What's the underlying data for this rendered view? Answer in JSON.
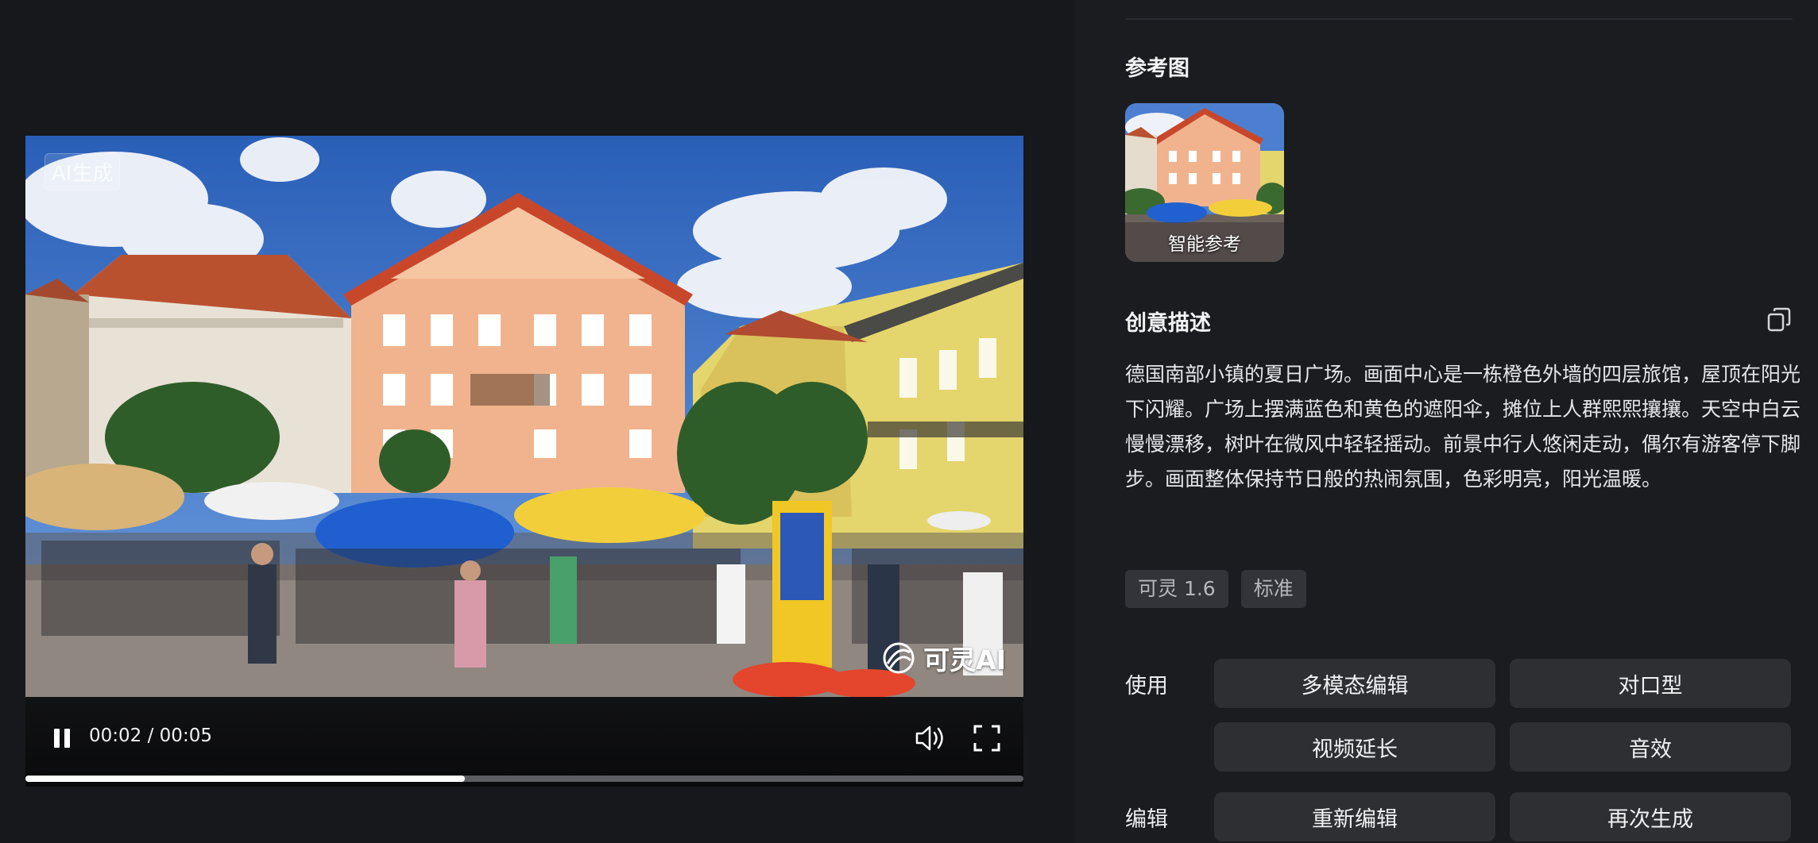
{
  "player": {
    "ai_tag": "AI生成",
    "watermark": "可灵AI",
    "time_current": "00:02",
    "time_separator": " / ",
    "time_total": "00:05",
    "progress_fraction": 0.44,
    "icons": {
      "pause": "pause-icon",
      "volume": "volume-icon",
      "fullscreen": "fullscreen-icon",
      "logo": "kling-logo-icon"
    }
  },
  "panel": {
    "reference": {
      "title": "参考图",
      "thumb_label": "智能参考"
    },
    "description": {
      "title": "创意描述",
      "copy_icon": "copy-icon",
      "text": "德国南部小镇的夏日广场。画面中心是一栋橙色外墙的四层旅馆，屋顶在阳光下闪耀。广场上摆满蓝色和黄色的遮阳伞，摊位上人群熙熙攘攘。天空中白云慢慢漂移，树叶在微风中轻轻摇动。前景中行人悠闲走动，偶尔有游客停下脚步。画面整体保持节日般的热闹氛围，色彩明亮，阳光温暖。"
    },
    "tags": [
      "可灵 1.6",
      "标准"
    ],
    "use": {
      "label": "使用",
      "buttons": [
        "多模态编辑",
        "对口型",
        "视频延长",
        "音效"
      ]
    },
    "edit": {
      "label": "编辑",
      "buttons": [
        "重新编辑",
        "再次生成"
      ]
    }
  }
}
